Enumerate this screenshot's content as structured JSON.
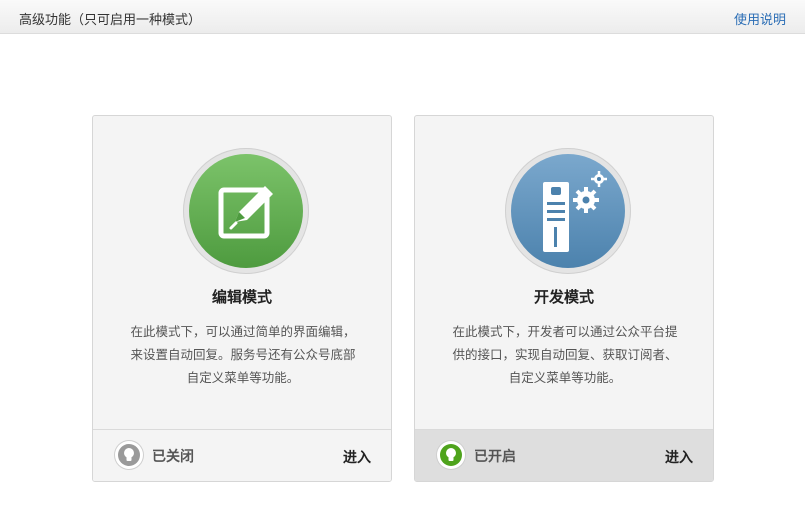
{
  "header": {
    "title": "高级功能（只可启用一种模式）",
    "help_link": "使用说明"
  },
  "cards": [
    {
      "name": "编辑模式",
      "icon": "edit-pencil-icon",
      "description": [
        "在此模式下，可以通过简单的界面编辑，",
        "来设置自动回复。服务号还有公众号底部",
        "自定义菜单等功能。"
      ],
      "status": "已关闭",
      "status_icon": "bulb-off-icon",
      "action": "进入",
      "accent": "#5fb04e"
    },
    {
      "name": "开发模式",
      "icon": "server-gear-icon",
      "description": [
        "在此模式下，开发者可以通过公众平台提",
        "供的接口，实现自动回复、获取订阅者、",
        "自定义菜单等功能。"
      ],
      "status": "已开启",
      "status_icon": "bulb-on-icon",
      "action": "进入",
      "accent": "#5a8fb8"
    }
  ]
}
